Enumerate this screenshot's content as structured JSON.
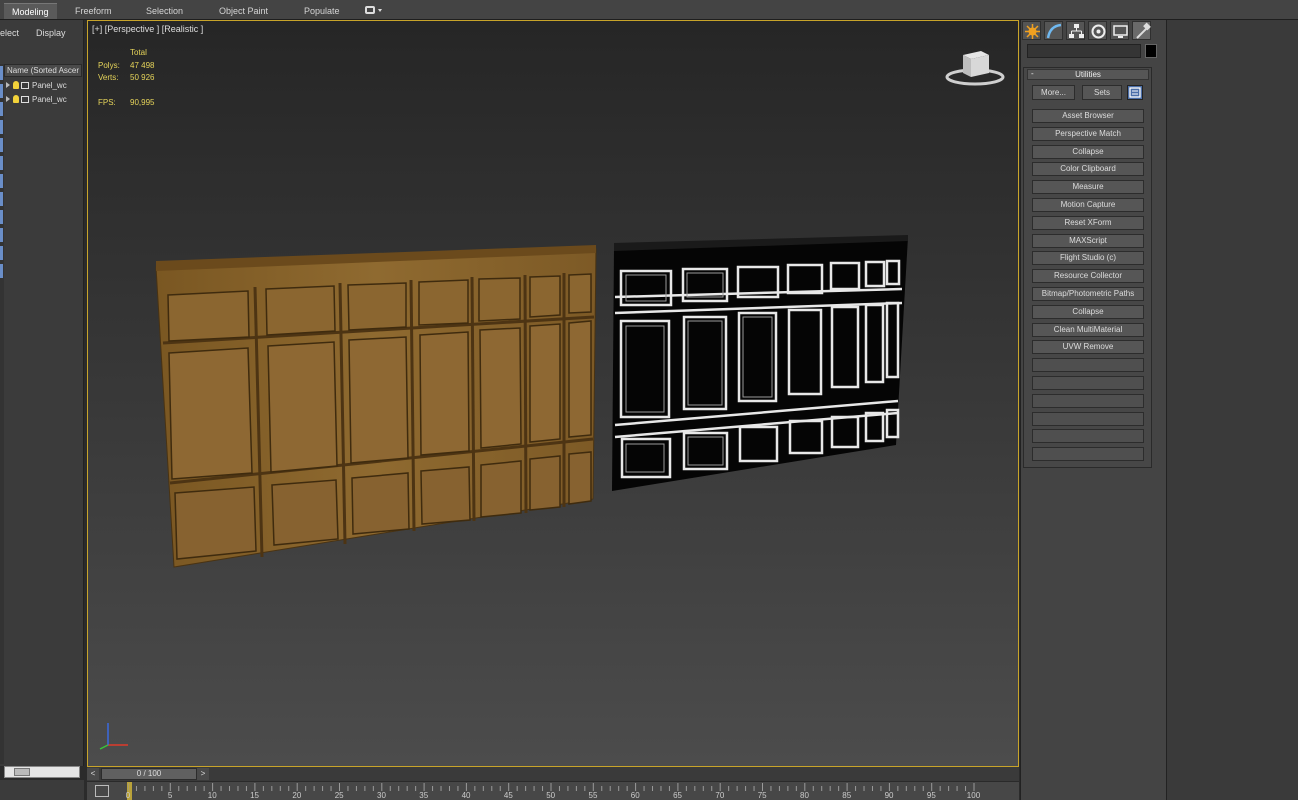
{
  "ribbon": {
    "tabs": [
      "Modeling",
      "Freeform",
      "Selection",
      "Object Paint",
      "Populate"
    ],
    "active_tab": "Modeling"
  },
  "scene_explorer": {
    "menus": [
      "elect",
      "Display"
    ],
    "column_header": "Name (Sorted Ascer",
    "items": [
      "Panel_wc",
      "Panel_wc"
    ]
  },
  "viewport": {
    "label": "[+] [Perspective ] [Realistic ]",
    "stats": {
      "header": "Total",
      "polys_label": "Polys:",
      "polys_value": "47 498",
      "verts_label": "Verts:",
      "verts_value": "50 926",
      "fps_label": "FPS:",
      "fps_value": "90,995"
    },
    "border_color": "#c8a42a",
    "stats_color": "#e6d45a"
  },
  "command_panel": {
    "tabs": [
      "create-icon",
      "modify-icon",
      "hierarchy-icon",
      "motion-icon",
      "display-icon",
      "utilities-icon"
    ],
    "active_tab": "utilities-icon",
    "rollout_title": "Utilities",
    "rollout_toggle": "-",
    "more_label": "More...",
    "sets_label": "Sets",
    "utilities": [
      "Asset Browser",
      "Perspective Match",
      "Collapse",
      "Color Clipboard",
      "Measure",
      "Motion Capture",
      "Reset XForm",
      "MAXScript",
      "Flight Studio (c)",
      "Resource Collector",
      "Bitmap/Photometric Paths",
      "Collapse",
      "Clean MultiMaterial",
      "UVW Remove",
      "",
      "",
      "",
      "",
      "",
      ""
    ]
  },
  "timeline": {
    "slider_label": "0 / 100",
    "prev_label": "<",
    "next_label": ">",
    "ticks": [
      "0",
      "5",
      "10",
      "15",
      "20",
      "25",
      "30",
      "35",
      "40",
      "45",
      "50",
      "55",
      "60",
      "65",
      "70",
      "75",
      "80",
      "85",
      "90",
      "95",
      "100"
    ]
  }
}
